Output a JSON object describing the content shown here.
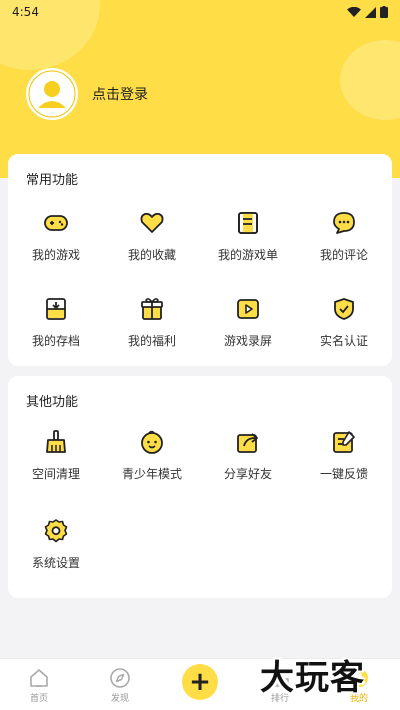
{
  "status_bar": {
    "time": "4:54"
  },
  "profile": {
    "login_text": "点击登录"
  },
  "common": {
    "title": "常用功能",
    "items": [
      {
        "label": "我的游戏",
        "icon": "gamepad-icon"
      },
      {
        "label": "我的收藏",
        "icon": "heart-icon"
      },
      {
        "label": "我的游戏单",
        "icon": "list-icon"
      },
      {
        "label": "我的评论",
        "icon": "comment-icon"
      },
      {
        "label": "我的存档",
        "icon": "archive-icon"
      },
      {
        "label": "我的福利",
        "icon": "gift-icon"
      },
      {
        "label": "游戏录屏",
        "icon": "record-icon"
      },
      {
        "label": "实名认证",
        "icon": "shield-icon"
      }
    ]
  },
  "other": {
    "title": "其他功能",
    "items": [
      {
        "label": "空间清理",
        "icon": "broom-icon"
      },
      {
        "label": "青少年模式",
        "icon": "child-icon"
      },
      {
        "label": "分享好友",
        "icon": "share-icon"
      },
      {
        "label": "一键反馈",
        "icon": "feedback-icon"
      },
      {
        "label": "系统设置",
        "icon": "gear-icon"
      }
    ]
  },
  "bottom_nav": {
    "items": [
      {
        "label": "首页",
        "icon": "home-icon"
      },
      {
        "label": "发现",
        "icon": "compass-icon"
      },
      {
        "label": "排行",
        "icon": "rank-icon"
      },
      {
        "label": "我的",
        "icon": "user-icon"
      }
    ],
    "plus": "+"
  },
  "watermark": "大玩客",
  "colors": {
    "accent": "#fedd47",
    "active": "#f0b400"
  }
}
